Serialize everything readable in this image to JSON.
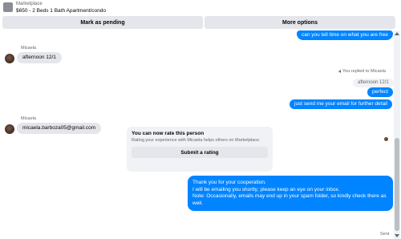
{
  "header": {
    "subtitle": "Marketplace",
    "title": "$650 - 2 Beds 1 Bath Apartment/condo"
  },
  "actions": {
    "mark_pending": "Mark as pending",
    "more_options": "More options"
  },
  "messages": {
    "out_top": "can you tell time on what you are free",
    "sender_1": "Micaela",
    "in_1": "afternoon 12/1",
    "reply_note": "You replied to Micaela",
    "quoted": "afternoon 12/1",
    "out_perfect": "perfect",
    "out_email": "just send me your email for further detail",
    "sender_2": "Micaela",
    "in_2": "micaela.barboza05@gmail.com"
  },
  "rating": {
    "title": "You can now rate this person",
    "text": "Rating your experience with Micaela helps others on Marketplace.",
    "button": "Submit a rating"
  },
  "final_message": {
    "lines": [
      "Thank you for your cooperation.",
      "I will be emailing you shortly; please keep an eye on your inbox.",
      "Note: Occasionally, emails may end up in your spam folder, so kindly check there as",
      "well."
    ]
  },
  "status": {
    "sent": "Sent"
  }
}
